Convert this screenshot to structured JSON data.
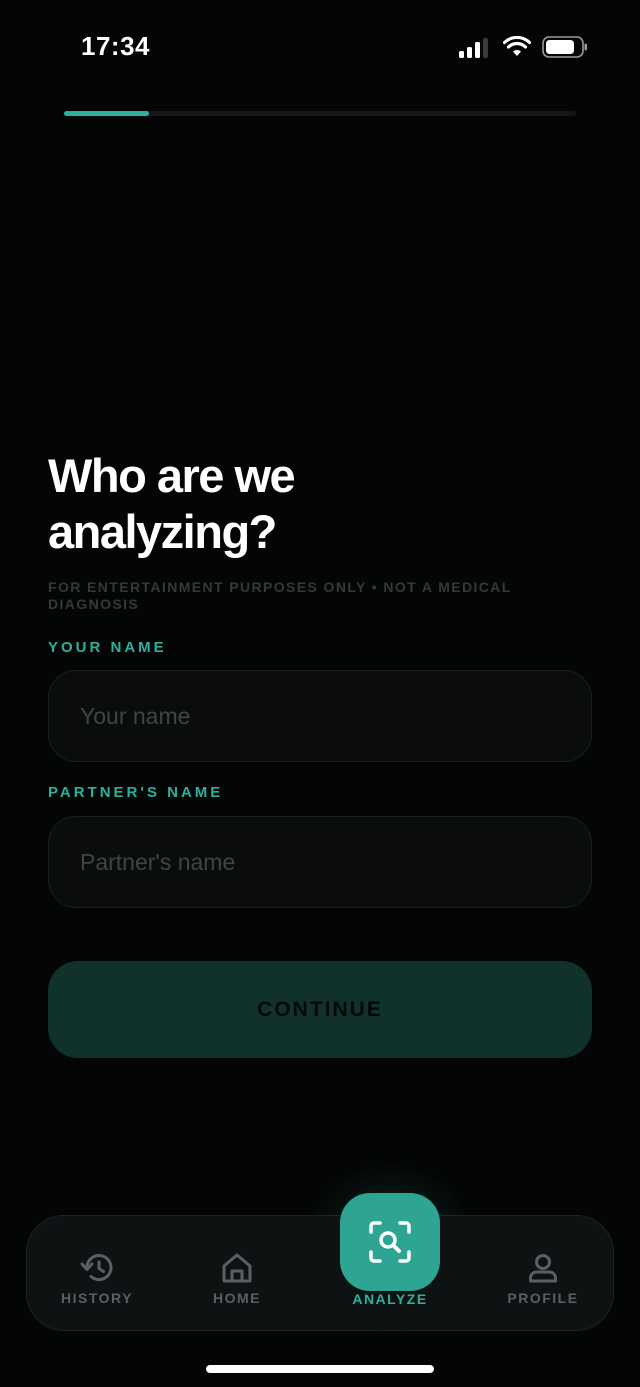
{
  "status_bar": {
    "time": "17:34",
    "signal_icon": "cellular-signal-icon",
    "wifi_icon": "wifi-icon",
    "battery_icon": "battery-icon"
  },
  "progress": {
    "value": 0.166
  },
  "header": {
    "title_line1": "Who are we",
    "title_line2": "analyzing?",
    "disclaimer": "FOR ENTERTAINMENT PURPOSES ONLY • NOT A MEDICAL DIAGNOSIS"
  },
  "form": {
    "your_name": {
      "label": "YOUR NAME",
      "placeholder": "Your name",
      "value": ""
    },
    "partner_name": {
      "label": "PARTNER'S NAME",
      "placeholder": "Partner's name",
      "value": ""
    },
    "continue_label": "CONTINUE"
  },
  "nav": {
    "items": [
      {
        "label": "HISTORY",
        "icon": "history-icon"
      },
      {
        "label": "HOME",
        "icon": "home-icon"
      },
      {
        "label": "ANALYZE",
        "icon": "scan-search-icon"
      },
      {
        "label": "PROFILE",
        "icon": "profile-icon"
      }
    ]
  },
  "colors": {
    "accent": "#2fb09c",
    "background": "#040505",
    "button_disabled": "#11312c"
  }
}
